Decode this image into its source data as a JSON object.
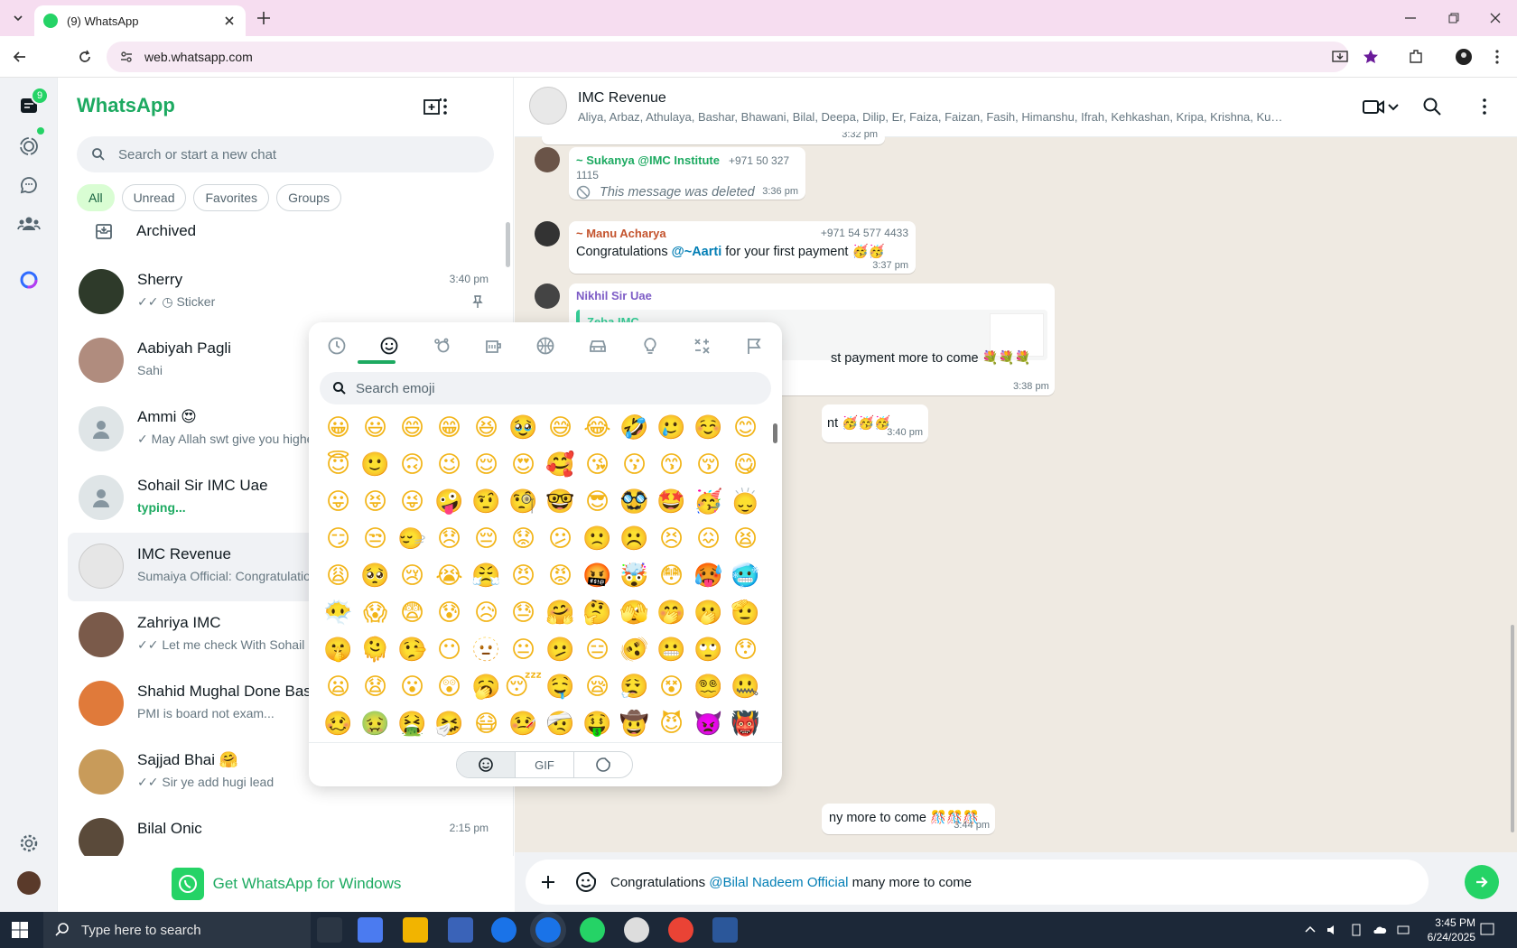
{
  "browser": {
    "tab_title": "(9) WhatsApp",
    "url": "web.whatsapp.com"
  },
  "rail": {
    "chats_badge": "9"
  },
  "sidebar": {
    "brand": "WhatsApp",
    "search_placeholder": "Search or start a new chat",
    "filters": [
      "All",
      "Unread",
      "Favorites",
      "Groups"
    ],
    "archived_label": "Archived",
    "chats": [
      {
        "name": "Sherry",
        "preview": "✓✓ ◷ Sticker",
        "time": "3:40 pm"
      },
      {
        "name": "Aabiyah Pagli",
        "preview": "Sahi",
        "time": ""
      },
      {
        "name": "Ammi 😍",
        "preview": "✓ May Allah swt give you highest",
        "time": ""
      },
      {
        "name": "Sohail Sir IMC Uae",
        "preview": "typing...",
        "time": ""
      },
      {
        "name": "IMC Revenue",
        "preview": "Sumaiya Official: Congratulations @",
        "time": ""
      },
      {
        "name": "Zahriya IMC",
        "preview": "✓✓ Let me check With Sohail Sir",
        "time": ""
      },
      {
        "name": "Shahid Mughal Done Base",
        "preview": "PMI is board not exam...",
        "time": ""
      },
      {
        "name": "Sajjad Bhai 🤗",
        "preview": "✓✓ Sir ye add hugi lead",
        "time": ""
      },
      {
        "name": "Bilal Onic",
        "preview": "",
        "time": "2:15 pm"
      }
    ],
    "get_app": "Get WhatsApp for Windows"
  },
  "conversation": {
    "group_name": "IMC Revenue",
    "members": "Aliya, Arbaz, Athulaya, Bashar, Bhawani, Bilal, Deepa, Dilip, Er, Faiza, Faizan, Fasih, Himanshu, Ifrah, Kehkashan, Kripa, Krishna, Kumkum, Mahvish...",
    "top_time": "3:32 pm",
    "messages": [
      {
        "sender": "~ Sukanya @IMC Institute",
        "phone": "+971 50 327 1115",
        "text": "This message was deleted",
        "time": "3:36 pm"
      },
      {
        "sender": "~ Manu Acharya",
        "phone": "+971 54 577 4433",
        "text_pre": "Congratulations ",
        "mention": "@~Aarti",
        "text_post": "  for your first payment 🥳🥳",
        "time": "3:37 pm"
      },
      {
        "sender": "Nikhil Sir Uae",
        "quote_sender": "Zeba IMC",
        "text": "st payment more to come 💐💐💐",
        "time": "3:38 pm"
      },
      {
        "text": "nt 🥳🥳🥳",
        "time": "3:40 pm"
      },
      {
        "text": "ny more to come 🎊🎊🎊",
        "time": "3:44 pm"
      }
    ],
    "composer": {
      "pre": "Congratulations ",
      "mention": "@Bilal Nadeem Official",
      "post": " many more to come"
    }
  },
  "emoji_panel": {
    "search_placeholder": "Search emoji",
    "tabs": [
      "recent-icon",
      "smiley-icon",
      "animal-icon",
      "food-icon",
      "activity-icon",
      "travel-icon",
      "objects-icon",
      "symbols-icon",
      "flags-icon"
    ],
    "bottom_tabs": [
      "emoji",
      "GIF",
      "sticker"
    ],
    "emojis": [
      "😀",
      "😃",
      "😄",
      "😁",
      "😆",
      "🥹",
      "😅",
      "😂",
      "🤣",
      "🥲",
      "☺️",
      "😊",
      "😇",
      "🙂",
      "🙃",
      "😉",
      "😌",
      "😍",
      "🥰",
      "😘",
      "😗",
      "😙",
      "😚",
      "😋",
      "😛",
      "😝",
      "😜",
      "🤪",
      "🤨",
      "🧐",
      "🤓",
      "😎",
      "🥸",
      "🤩",
      "🥳",
      "🙂‍↕️",
      "😏",
      "😒",
      "🙂‍↔️",
      "😞",
      "😔",
      "😟",
      "😕",
      "🙁",
      "☹️",
      "😣",
      "😖",
      "😫",
      "😩",
      "🥺",
      "😢",
      "😭",
      "😤",
      "😠",
      "😡",
      "🤬",
      "🤯",
      "😳",
      "🥵",
      "🥶",
      "😶‍🌫️",
      "😱",
      "😨",
      "😰",
      "😥",
      "😓",
      "🤗",
      "🤔",
      "🫣",
      "🤭",
      "🫢",
      "🫡",
      "🤫",
      "🫠",
      "🤥",
      "😶",
      "🫥",
      "😐",
      "🫤",
      "😑",
      "🫨",
      "😬",
      "🙄",
      "😯",
      "😦",
      "😧",
      "😮",
      "😲",
      "🥱",
      "😴",
      "🤤",
      "😪",
      "😮‍💨",
      "😵",
      "😵‍💫",
      "🤐",
      "🥴",
      "🤢",
      "🤮",
      "🤧",
      "😷",
      "🤒",
      "🤕",
      "🤑",
      "🤠",
      "😈",
      "👿",
      "👹"
    ]
  },
  "taskbar": {
    "search_placeholder": "Type here to search",
    "time": "3:45 PM",
    "date": "6/24/2025"
  }
}
